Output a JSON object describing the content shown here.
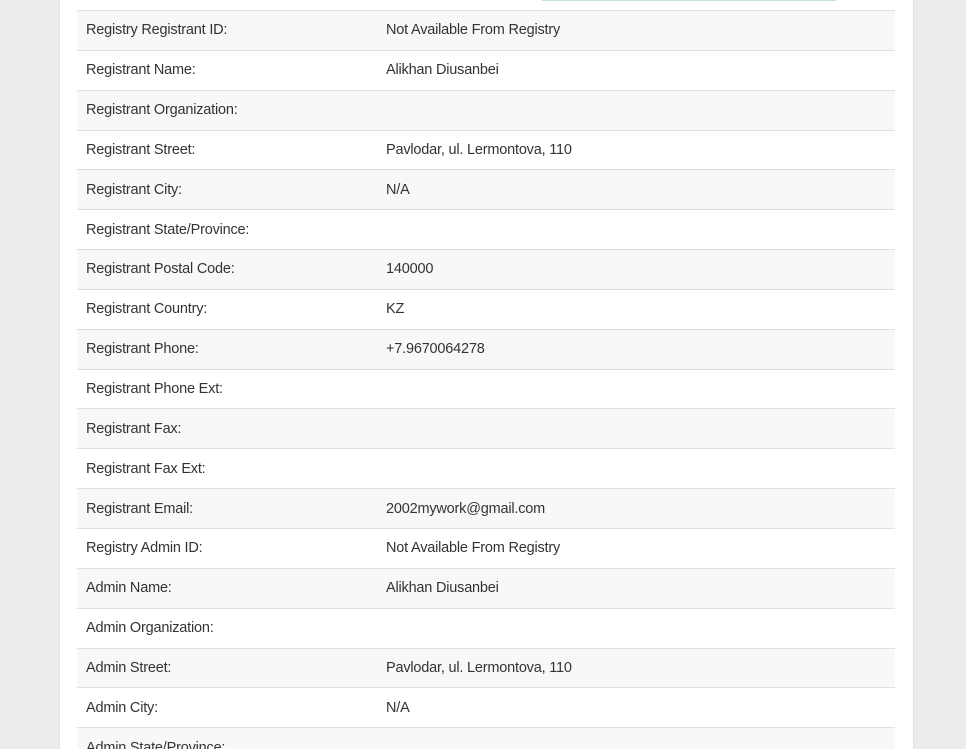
{
  "whois": {
    "rows": [
      {
        "label": "Registry Registrant ID:",
        "value": "Not Available From Registry"
      },
      {
        "label": "Registrant Name:",
        "value": "Alikhan Diusanbei"
      },
      {
        "label": "Registrant Organization:",
        "value": ""
      },
      {
        "label": "Registrant Street:",
        "value": "Pavlodar, ul. Lermontova, 110"
      },
      {
        "label": "Registrant City:",
        "value": "N/A"
      },
      {
        "label": "Registrant State/Province:",
        "value": ""
      },
      {
        "label": "Registrant Postal Code:",
        "value": "140000"
      },
      {
        "label": "Registrant Country:",
        "value": "KZ"
      },
      {
        "label": "Registrant Phone:",
        "value": "+7.9670064278"
      },
      {
        "label": "Registrant Phone Ext:",
        "value": ""
      },
      {
        "label": "Registrant Fax:",
        "value": ""
      },
      {
        "label": "Registrant Fax Ext:",
        "value": ""
      },
      {
        "label": "Registrant Email:",
        "value": "2002mywork@gmail.com"
      },
      {
        "label": "Registry Admin ID:",
        "value": "Not Available From Registry"
      },
      {
        "label": "Admin Name:",
        "value": "Alikhan Diusanbei"
      },
      {
        "label": "Admin Organization:",
        "value": ""
      },
      {
        "label": "Admin Street:",
        "value": "Pavlodar, ul. Lermontova, 110"
      },
      {
        "label": "Admin City:",
        "value": "N/A"
      },
      {
        "label": "Admin State/Province:",
        "value": ""
      }
    ]
  }
}
